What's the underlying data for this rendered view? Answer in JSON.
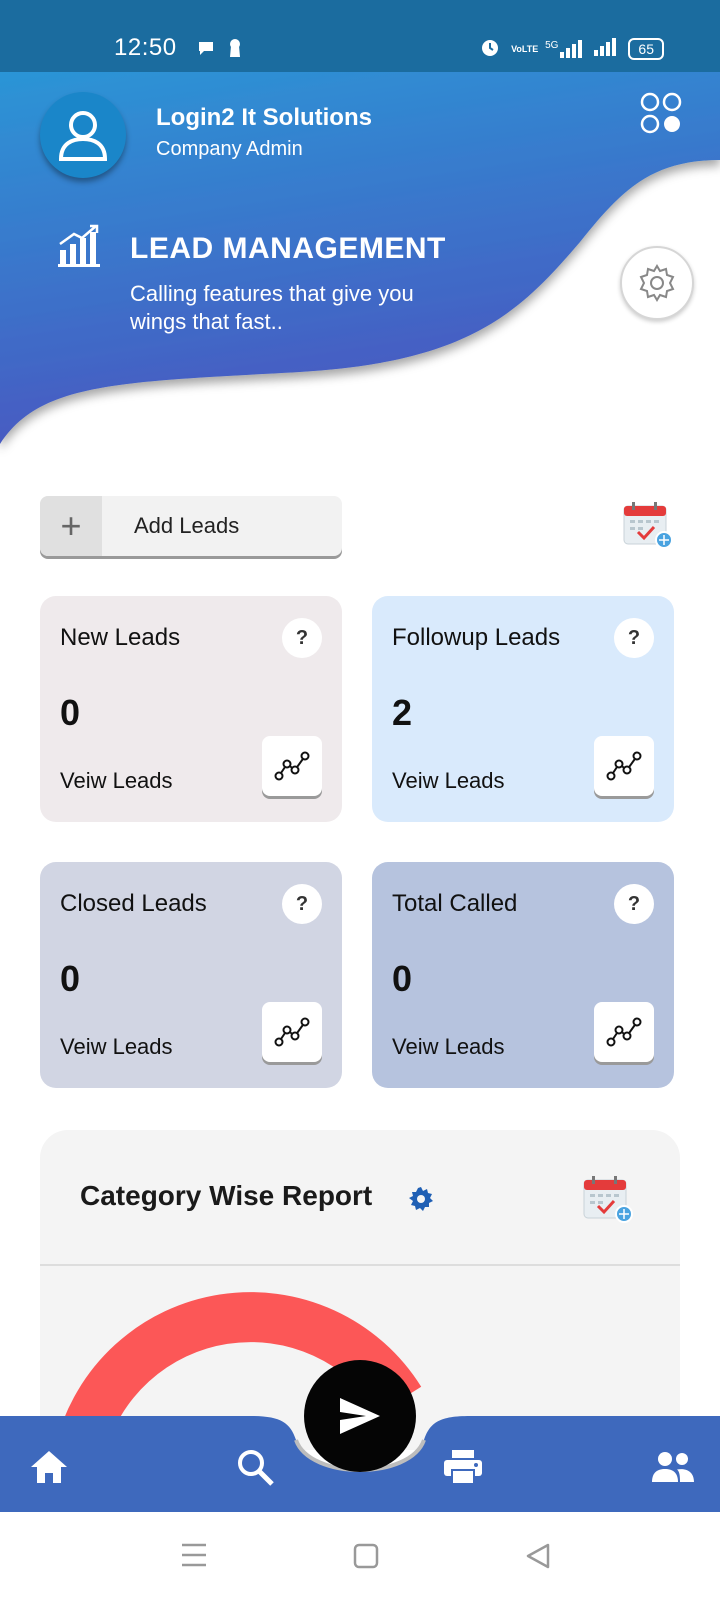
{
  "status_bar": {
    "time": "12:50",
    "left_icons": [
      "chat-bubble-icon",
      "keyhole-icon"
    ],
    "right_icons": [
      "alarm-icon",
      "volte-icon",
      "5g-signal-icon",
      "signal-icon"
    ],
    "network": "5G",
    "volte": "VoLTE",
    "battery": "65"
  },
  "header": {
    "company_name": "Login2 It Solutions",
    "role": "Company Admin",
    "title": "LEAD MANAGEMENT",
    "subtitle": "Calling features that give you\n wings that fast..",
    "gradient_top": "#2b95d6",
    "gradient_bottom": "#4a56c0"
  },
  "add_leads": {
    "label": "Add Leads",
    "icon": "+"
  },
  "cards": [
    {
      "title": "New Leads",
      "value": "0",
      "link": "Veiw Leads",
      "help": "?",
      "color": "#efeaec"
    },
    {
      "title": "Followup Leads",
      "value": "2",
      "link": "Veiw Leads",
      "help": "?",
      "color": "#d9eafc"
    },
    {
      "title": "Closed Leads",
      "value": "0",
      "link": "Veiw Leads",
      "help": "?",
      "color": "#d1d5e3"
    },
    {
      "title": "Total Called",
      "value": "0",
      "link": "Veiw Leads",
      "help": "?",
      "color": "#b6c3de"
    }
  ],
  "report": {
    "title": "Category Wise Report",
    "donut_color": "#fc5757",
    "gear_color": "#1f5fb4"
  },
  "bottom_nav": {
    "color": "#3e69bd",
    "items": [
      "home-icon",
      "search-icon",
      "send-icon",
      "print-icon",
      "group-icon"
    ]
  },
  "system_nav": [
    "menu-icon",
    "home-square-icon",
    "back-icon"
  ]
}
